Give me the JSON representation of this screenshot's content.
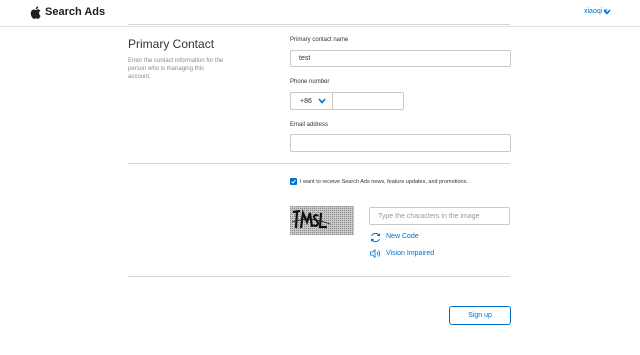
{
  "header": {
    "brand": "Search Ads",
    "user_name": "xiaoqi x.",
    "logo_icon": "apple-icon",
    "user_menu_icon": "chevron-down-icon"
  },
  "primary_contact": {
    "title": "Primary Contact",
    "description": "Enter the contact information for the person who is managing this account.",
    "name_label": "Primary contact name",
    "name_value": "test",
    "phone_label": "Phone number",
    "country_code": "+86",
    "phone_value": "",
    "email_label": "Email address",
    "email_value": ""
  },
  "consent": {
    "checked": true,
    "text": "I want to receive Search Ads news, feature updates, and promotions."
  },
  "captcha": {
    "image_text": "7M5L",
    "placeholder": "Type the characters in the image",
    "new_code_label": "New Code",
    "vision_impaired_label": "Vision Impaired"
  },
  "actions": {
    "signup_label": "Sign up"
  },
  "colors": {
    "accent": "#0070c9",
    "border": "#c9c9c9",
    "divider": "#d6d6d6"
  }
}
